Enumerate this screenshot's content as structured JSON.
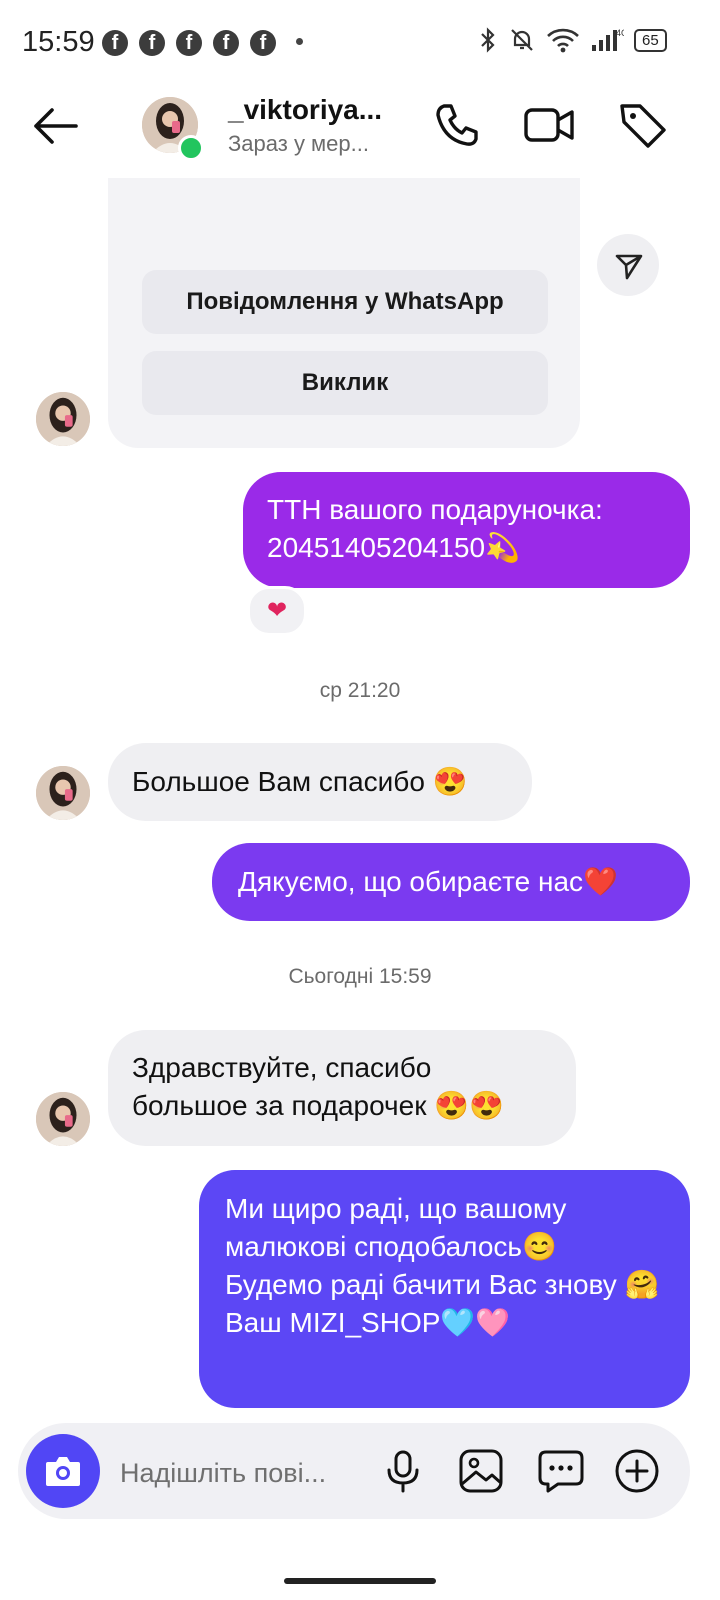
{
  "status_bar": {
    "time": "15:59",
    "fb_count": 5,
    "network": "4G",
    "battery": "65"
  },
  "header": {
    "username": "_viktoriya...",
    "status": "Зараз у мер..."
  },
  "shared_card": {
    "whatsapp_button": "Повідомлення у WhatsApp",
    "call_button": "Виклик"
  },
  "messages": [
    {
      "dir": "out",
      "text": "ТТН вашого подаруночка: 20451405204150💫",
      "reaction": "❤"
    },
    {
      "dir": "ts",
      "text": "ср 21:20"
    },
    {
      "dir": "in",
      "text": "Большое Вам спасибо 😍"
    },
    {
      "dir": "out",
      "text": "Дякуємо, що обираєте нас❤️"
    },
    {
      "dir": "ts",
      "text": "Сьогодні 15:59"
    },
    {
      "dir": "in",
      "text": "Здравствуйте, спасибо большое за подарочек 😍😍"
    },
    {
      "dir": "out",
      "text": "Ми щиро раді, що вашому малюкові сподобалось😊\nБудемо раді бачити Вас знову 🤗\nВаш MIZI_SHOP🩵🩷"
    }
  ],
  "composer": {
    "placeholder": "Надішліть пові..."
  },
  "colors": {
    "out_purple": "#9a2ae8",
    "out_violet": "#7b3af0",
    "out_indigo": "#5c47f5",
    "in_bubble": "#efeff2",
    "camera_button": "#5146f5",
    "online": "#22c55e"
  }
}
